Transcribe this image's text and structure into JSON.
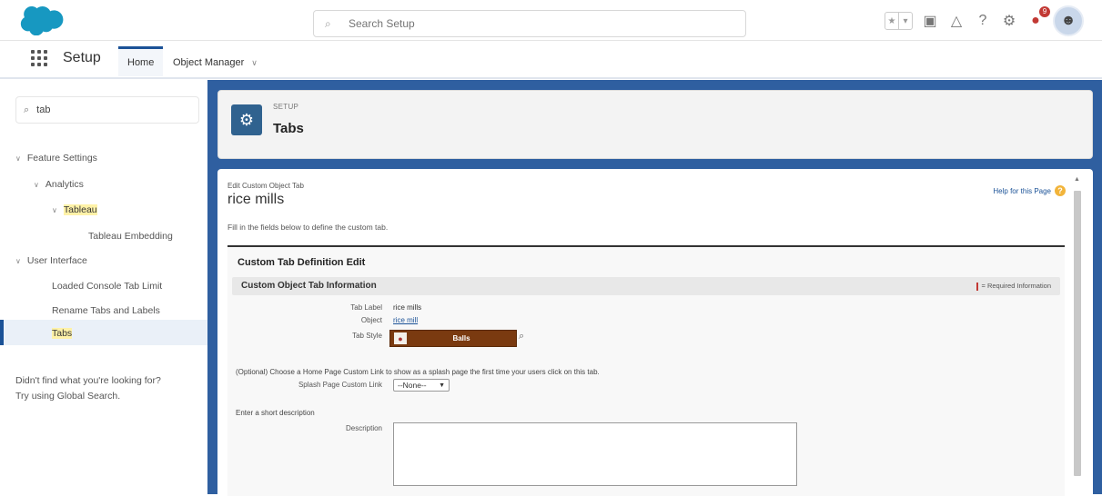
{
  "header": {
    "search_placeholder": "Search Setup",
    "notification_count": "9"
  },
  "nav": {
    "app_name": "Setup",
    "tabs": [
      {
        "label": "Home"
      },
      {
        "label": "Object Manager"
      }
    ]
  },
  "sidebar": {
    "search_value": "tab",
    "tree": {
      "feature_settings": "Feature Settings",
      "analytics": "Analytics",
      "tableau": "Tableau",
      "tableau_embedding": "Tableau Embedding",
      "user_interface": "User Interface",
      "loaded_console": "Loaded Console Tab Limit",
      "rename_tabs": "Rename Tabs and Labels",
      "tabs": "Tabs"
    },
    "help_line1": "Didn't find what you're looking for?",
    "help_line2": "Try using Global Search."
  },
  "page_header": {
    "eyebrow": "SETUP",
    "title": "Tabs"
  },
  "content": {
    "breadcrumb": "Edit Custom Object Tab",
    "record_title": "rice mills",
    "help_link": "Help for this Page",
    "intro": "Fill in the fields below to define the custom tab.",
    "definition_title": "Custom Tab Definition Edit",
    "section_title": "Custom Object Tab Information",
    "required_info": "= Required Information",
    "fields": {
      "tab_label_label": "Tab Label",
      "tab_label_value": "rice mills",
      "object_label": "Object",
      "object_value": "rice mill",
      "tab_style_label": "Tab Style",
      "tab_style_value": "Balls"
    },
    "optional_text": "(Optional) Choose a Home Page Custom Link to show as a splash page the first time your users click on this tab.",
    "splash_label": "Splash Page Custom Link",
    "splash_value": "--None--",
    "desc_prompt": "Enter a short description",
    "desc_label": "Description",
    "desc_value": ""
  },
  "colors": {
    "brand": "#1b5297",
    "main_bg": "#2f5fa0",
    "tab_style": "#7a3a10"
  }
}
